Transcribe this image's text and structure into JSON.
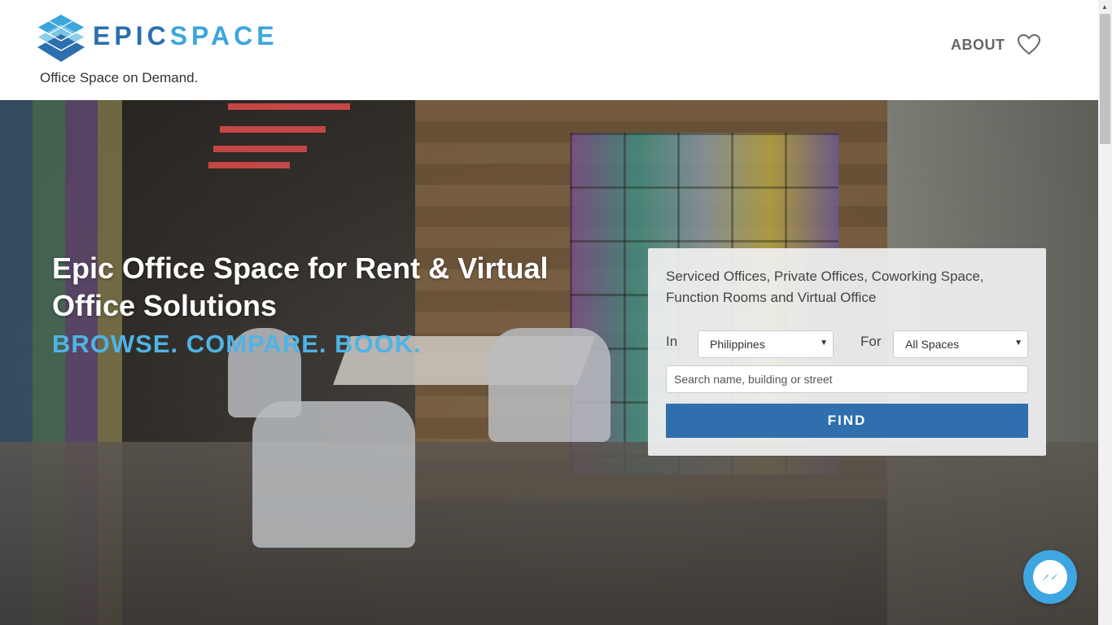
{
  "header": {
    "brand_epic": "EPIC",
    "brand_space": "SPACE",
    "tagline": "Office Space on Demand.",
    "nav_about": "ABOUT",
    "favorites_icon": "heart-icon"
  },
  "hero": {
    "title": "Epic Office Space for Rent & Virtual Office Solutions",
    "subtitle": "BROWSE. COMPARE. BOOK."
  },
  "search": {
    "description": "Serviced Offices, Private Offices, Coworking Space, Function Rooms and Virtual Office",
    "in_label": "In",
    "location_value": "Philippines",
    "for_label": "For",
    "type_value": "All Spaces",
    "query_placeholder": "Search name, building or street",
    "find_label": "FIND"
  },
  "chat": {
    "icon": "messenger-icon"
  },
  "colors": {
    "brand_dark": "#2b6fae",
    "brand_light": "#3ca6dc",
    "accent_sub": "#4fb3e6",
    "find_button": "#2f6fae",
    "messenger": "#3ea6e0"
  }
}
